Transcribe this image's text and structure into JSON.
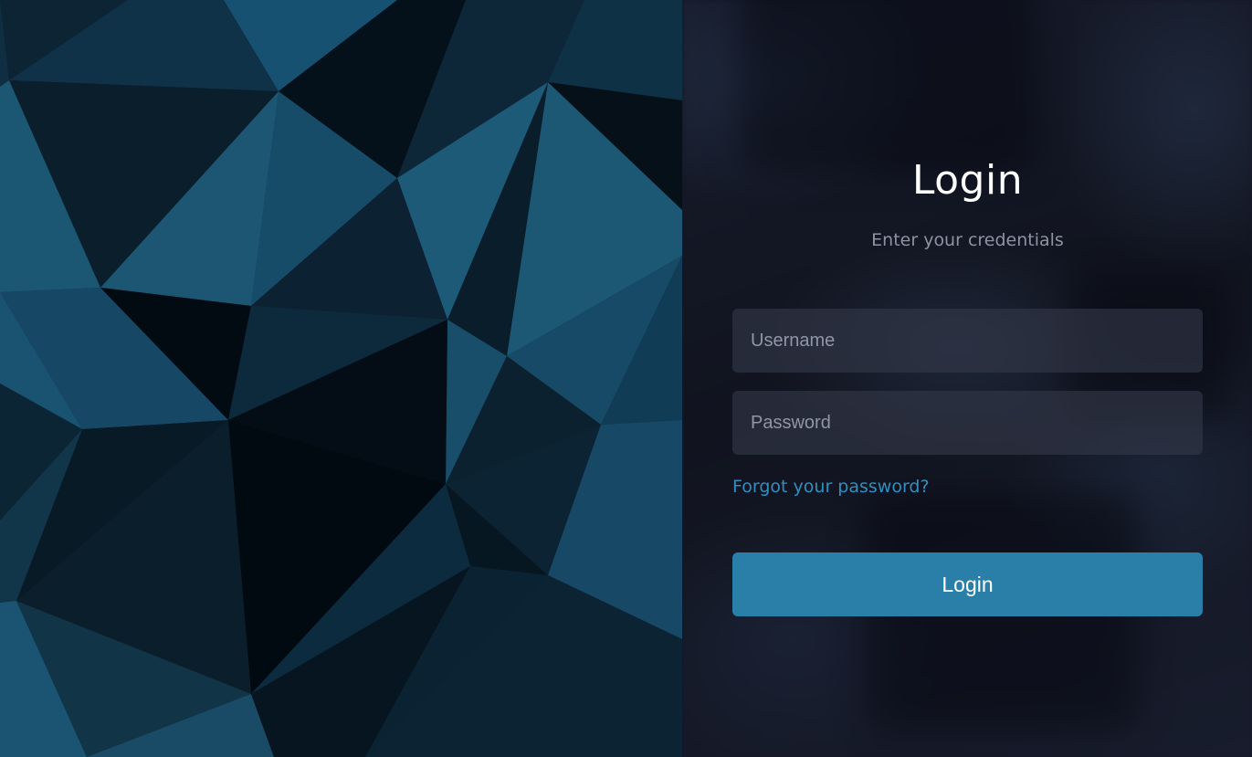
{
  "login": {
    "title": "Login",
    "subtitle": "Enter your credentials",
    "username": {
      "placeholder": "Username",
      "value": ""
    },
    "password": {
      "placeholder": "Password",
      "value": ""
    },
    "forgot_link": "Forgot your password?",
    "submit_label": "Login"
  },
  "colors": {
    "accent": "#2a7fa8",
    "link": "#2f8fc0",
    "panel_background": "#141827",
    "pattern_light": "#1d5872",
    "pattern_dark": "#020a12"
  },
  "decorations": {
    "left_panel": "low-poly-triangle-pattern"
  }
}
